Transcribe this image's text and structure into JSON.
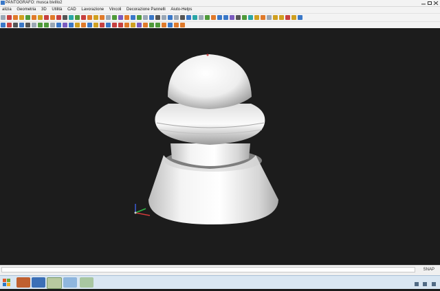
{
  "window": {
    "title": "PANTOGRAFO: musca bivillo2"
  },
  "menu": [
    "alizia",
    "Geometria",
    "3D",
    "Utilità",
    "CAD",
    "Lavorazione",
    "Vincoli",
    "Decorazione Pannelli",
    "Aiuto-Helps"
  ],
  "toolbar_icons_row1": [
    "new-icon",
    "open-icon",
    "save-icon",
    "print-icon",
    "cut-icon",
    "copy-icon",
    "paste-icon",
    "undo-icon",
    "redo-icon",
    "zoom-in-icon",
    "zoom-out-icon",
    "pan-icon",
    "select-icon",
    "grid-icon",
    "snap-icon",
    "layer-icon",
    "measure-icon",
    "rotate-icon",
    "mirror-icon",
    "scale-icon",
    "move-icon",
    "line-icon",
    "arc-icon",
    "circle-icon",
    "rect-icon",
    "polyline-icon",
    "spline-icon",
    "text-icon",
    "dimension-icon",
    "hatch-icon",
    "trim-icon",
    "extend-icon",
    "offset-icon",
    "fillet-icon",
    "chamfer-icon",
    "explode-icon",
    "join-icon",
    "array-icon",
    "block-icon",
    "insert-icon",
    "render-icon",
    "view-top-icon",
    "view-front-icon",
    "view-side-icon",
    "view-iso-icon",
    "shade-icon",
    "wire-icon",
    "settings-icon",
    "help-icon"
  ],
  "toolbar_icons_row2": [
    "tool-icon",
    "mill-icon",
    "drill-icon",
    "path-icon",
    "simulate-icon",
    "export-icon",
    "import-icon",
    "cam-icon",
    "origin-icon",
    "axis-icon",
    "plane-icon",
    "surface-icon",
    "solid-icon",
    "extrude-icon",
    "revolve-icon",
    "sweep-icon",
    "loft-icon",
    "boolean-icon",
    "section-icon",
    "info-icon",
    "list-icon",
    "table-icon",
    "color-icon",
    "lock-icon",
    "unlock-icon",
    "eye-icon",
    "hide-icon",
    "show-icon",
    "refresh-icon",
    "stop-icon"
  ],
  "colors": {
    "accent": "#3a78c8",
    "viewport": "#1c1c1c"
  },
  "status": {
    "snap": "SNAP"
  }
}
